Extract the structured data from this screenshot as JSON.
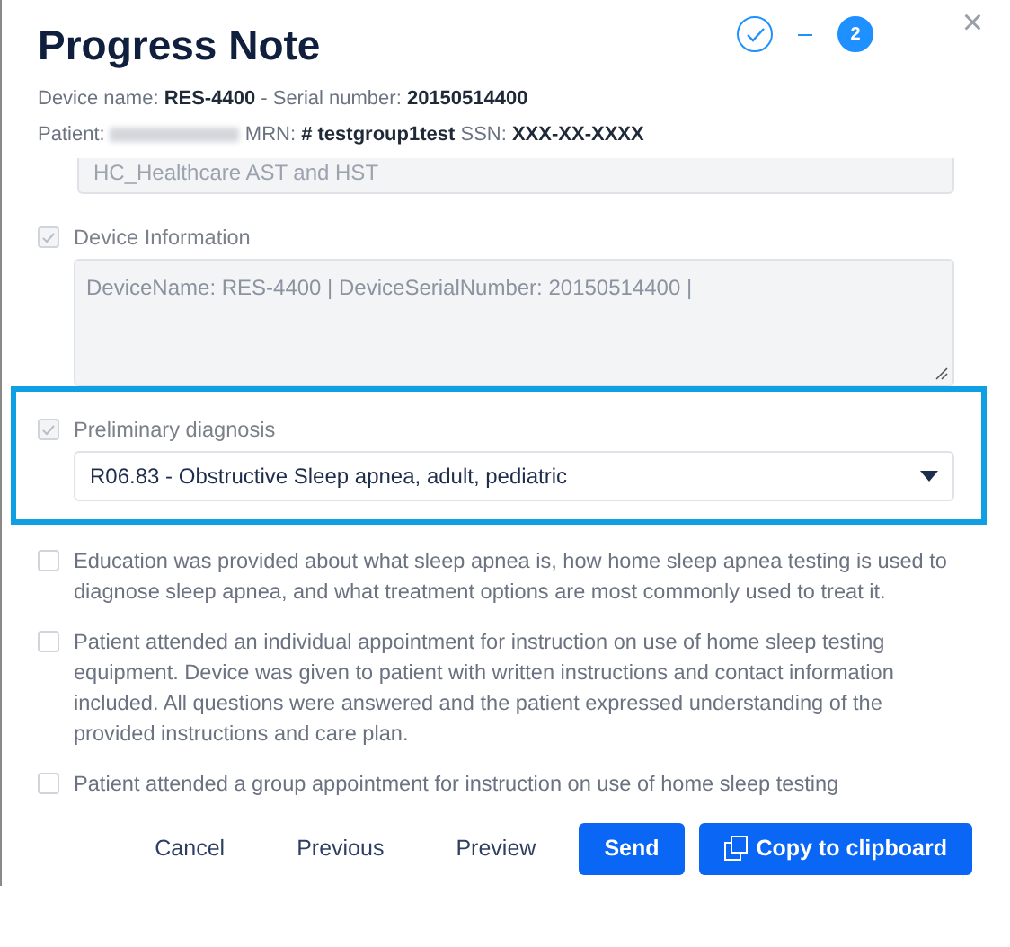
{
  "dialog": {
    "title": "Progress Note",
    "close": "×",
    "device_line": [
      {
        "label": "Device name: ",
        "value": "RES-4400"
      },
      {
        "label": " - Serial number: ",
        "value": "20150514400"
      }
    ],
    "patient_line": [
      {
        "label": "Patient: ",
        "kind": "redacted"
      },
      {
        "label": " MRN: ",
        "value": "# testgroup1test"
      },
      {
        "label": " SSN: ",
        "value": "XXX-XX-XXXX"
      }
    ]
  },
  "stepper": [
    {
      "completed": true,
      "selected": false
    },
    {
      "label": "2",
      "completed": false,
      "selected": true
    }
  ],
  "items": [
    {
      "kind": "field",
      "value": "HC_Healthcare AST and HST"
    },
    {
      "kind": "textarea",
      "label": "Device Information",
      "checked": true,
      "disabled": true,
      "value": "DeviceName: RES-4400 | DeviceSerialNumber: 20150514400 |"
    },
    {
      "kind": "select",
      "label": "Preliminary diagnosis",
      "checked": true,
      "disabled": true,
      "highlighted": true,
      "value": "R06.83 - Obstructive Sleep apnea, adult, pediatric"
    },
    {
      "kind": "check",
      "label": "Education was provided about what sleep apnea is, how home sleep apnea testing is used to diagnose sleep apnea, and what treatment options are most commonly used to treat it.",
      "checked": false,
      "disabled": false
    },
    {
      "kind": "check",
      "label": "Patient attended an individual appointment for instruction on use of home sleep testing equipment. Device was given to patient with written instructions and contact information included. All questions were answered and the patient expressed understanding of the provided instructions and care plan.",
      "checked": false,
      "disabled": false
    },
    {
      "kind": "check",
      "label": "Patient attended a group appointment for instruction on use of home sleep testing",
      "checked": false,
      "disabled": false
    }
  ],
  "buttons": [
    {
      "label": "Cancel",
      "kind": "link"
    },
    {
      "label": "Previous",
      "kind": "link"
    },
    {
      "label": "Preview",
      "kind": "link"
    },
    {
      "label": "Send",
      "kind": "primary"
    },
    {
      "label": "Copy to clipboard",
      "kind": "copy"
    }
  ]
}
